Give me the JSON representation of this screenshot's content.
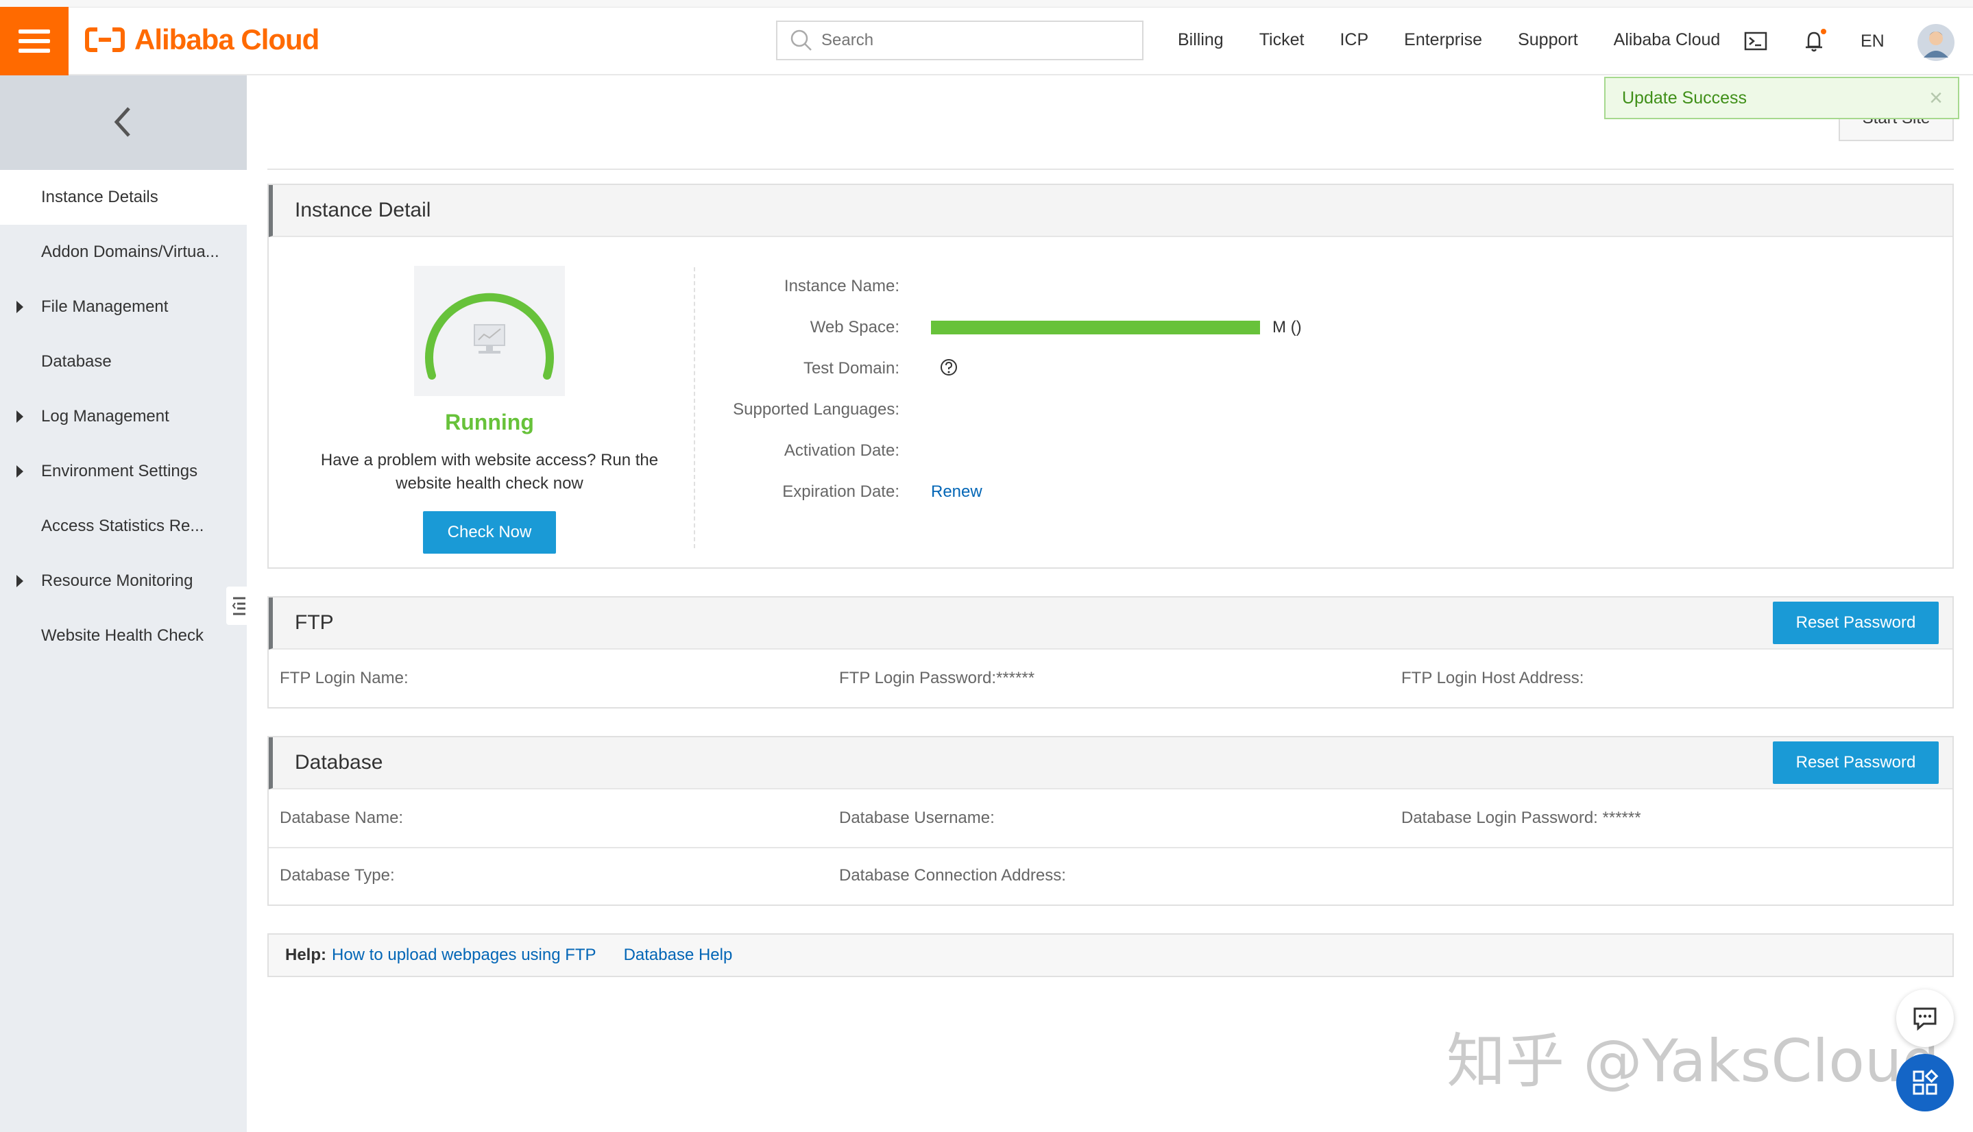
{
  "header": {
    "logo_text": "Alibaba Cloud",
    "search_placeholder": "Search",
    "nav": [
      "Billing",
      "Ticket",
      "ICP",
      "Enterprise",
      "Support",
      "Alibaba Cloud"
    ],
    "language": "EN",
    "brand_color": "#ff6a00"
  },
  "toast": {
    "message": "Update Success",
    "close": "×"
  },
  "start_site_label": "Start Site",
  "sidebar": {
    "items": [
      {
        "label": "Instance Details",
        "active": true
      },
      {
        "label": "Addon Domains/Virtua..."
      },
      {
        "label": "File Management",
        "expandable": true
      },
      {
        "label": "Database"
      },
      {
        "label": "Log Management",
        "expandable": true
      },
      {
        "label": "Environment Settings",
        "expandable": true
      },
      {
        "label": "Access Statistics Re..."
      },
      {
        "label": "Resource Monitoring",
        "expandable": true
      },
      {
        "label": "Website Health Check"
      }
    ]
  },
  "instance": {
    "title": "Instance Detail",
    "status": "Running",
    "status_color": "#67c23a",
    "health_text_line1": "Have a problem with website access? Run the",
    "health_text_line2": "website health check now",
    "check_button": "Check Now",
    "labels": {
      "name": "Instance Name:",
      "web_space": "Web Space:",
      "test_domain": "Test Domain:",
      "languages": "Supported Languages:",
      "activation": "Activation Date:",
      "expiration": "Expiration Date:"
    },
    "web_space_value": "M ()",
    "web_space_fill": 1.0,
    "renew_link": "Renew"
  },
  "ftp": {
    "title": "FTP",
    "reset_button": "Reset Password",
    "login_name": "FTP Login Name:",
    "login_password": "FTP Login Password:******",
    "host_address": "FTP Login Host Address:"
  },
  "database": {
    "title": "Database",
    "reset_button": "Reset Password",
    "name": "Database Name:",
    "username": "Database Username:",
    "login_password": "Database Login Password: ******",
    "type": "Database Type:",
    "connection": "Database Connection Address:"
  },
  "help": {
    "label": "Help:",
    "link1": "How to upload webpages using FTP",
    "link2": "Database Help"
  },
  "watermark": "知乎 @YaksCloud"
}
